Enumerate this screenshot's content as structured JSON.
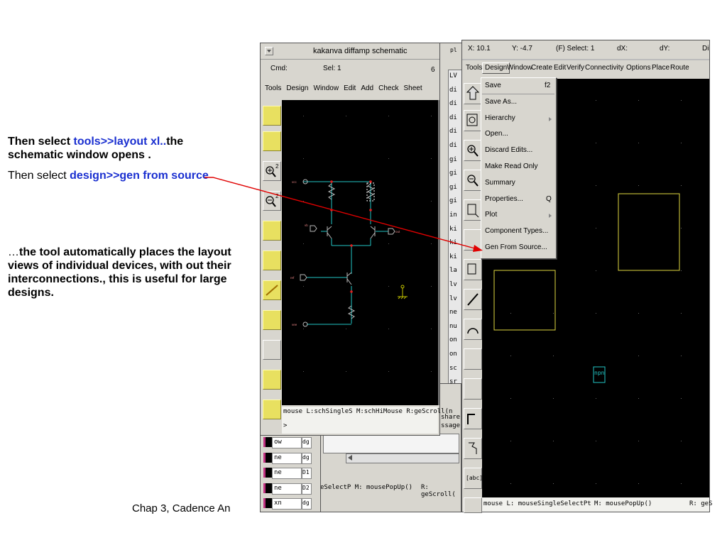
{
  "slide": {
    "p1_a": "Then select ",
    "p1_b": "tools>>layout xl..",
    "p1_c": "the schematic window opens .",
    "p2_a": "Then select ",
    "p2_b": "design>>gen from source",
    "p3_a": "…",
    "p3_b": "the tool automatically places the layout views of individual devices, with out their interconnections., this is useful for large designs.",
    "footer": "Chap 3, Cadence An"
  },
  "schematic": {
    "title": "kakanva diffamp schematic",
    "cmd": "Cmd:",
    "sel": "Sel: 1",
    "count": "6",
    "menu": [
      "Tools",
      "Design",
      "Window",
      "Edit",
      "Add",
      "Check",
      "Sheet"
    ],
    "status": "mouse L:schSingleS M:schHiMouse R:geScroll(n",
    "prompt": ">",
    "labels": {
      "npn": "npn"
    }
  },
  "layout": {
    "coords": {
      "x": "X: 10.1",
      "y": "Y: -4.7",
      "select": "(F) Select: 1",
      "dx": "dX:",
      "dy": "dY:",
      "dist": "Di"
    },
    "menu": [
      "Tools",
      "Design",
      "Window",
      "Create",
      "Edit",
      "Verify",
      "Connectivity",
      "Options",
      "Place",
      "Route"
    ],
    "status_l": "mouse L: mouseSingleSelectPt",
    "status_m": "M: mousePopUp()",
    "status_r": "R: geS",
    "instance_label": "npn",
    "abc": "[abc]"
  },
  "design_menu": {
    "items": [
      "Save",
      "Save As...",
      "Hierarchy",
      "Open...",
      "Discard Edits...",
      "Make Read Only",
      "Summary",
      "Properties...",
      "Plot",
      "Component Types...",
      "Gen From Source..."
    ],
    "shortcuts": {
      "save": "f2",
      "properties": "Q"
    }
  },
  "middle": {
    "lines": [
      "LV",
      "di",
      "di",
      "di",
      "di",
      "di",
      "gi",
      "gi",
      "gi",
      "gi",
      "in",
      "ki",
      "ki",
      "ki",
      "la",
      "lv",
      "lv",
      "ne",
      "nu",
      "on",
      "on",
      "sc",
      "sr",
      "te",
      "tv"
    ],
    "side_frag": "pl",
    "share": "share",
    "ssage": "ssage",
    "bottom_status": "eSelectP M: mousePopUp()",
    "bottom_status_r": "R: geScroll("
  },
  "layers": [
    {
      "name": "ow",
      "purpose": "dg"
    },
    {
      "name": "ne",
      "purpose": "dg"
    },
    {
      "name": "ne",
      "purpose": "D1"
    },
    {
      "name": "ne",
      "purpose": "D2"
    },
    {
      "name": "xn",
      "purpose": "dg"
    }
  ],
  "colors": {
    "accent_blue": "#1a2fd0",
    "arrow": "#e00000",
    "canvas": "#000000"
  }
}
